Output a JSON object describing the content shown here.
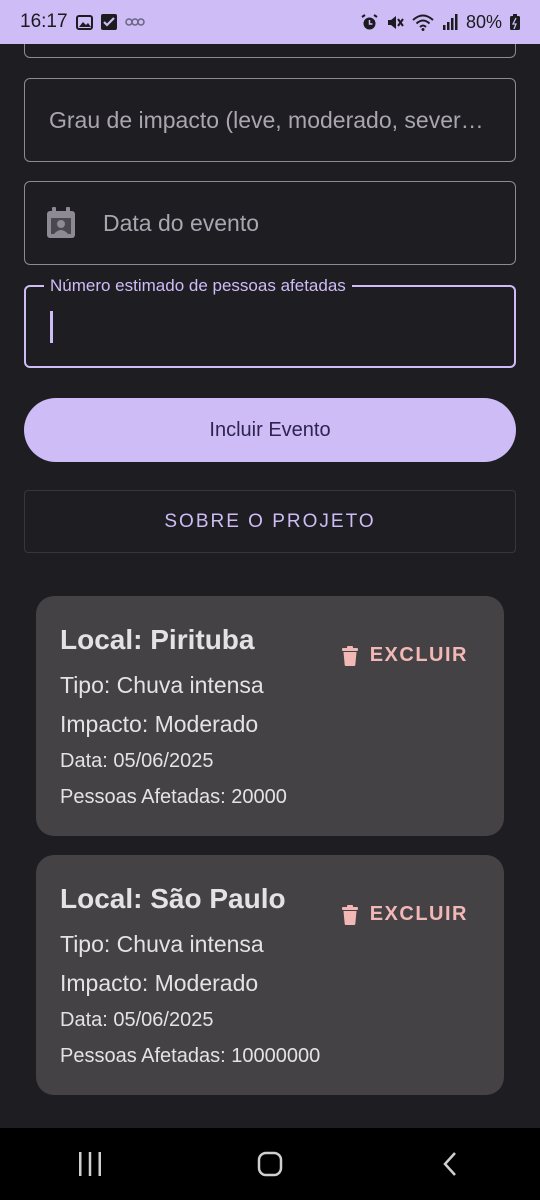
{
  "status_bar": {
    "time": "16:17",
    "battery": "80%"
  },
  "form": {
    "impact_placeholder": "Grau de impacto (leve, moderado, sever…",
    "date_placeholder": "Data do evento",
    "people_label": "Número estimado de pessoas afetadas",
    "people_value": ""
  },
  "buttons": {
    "include": "Incluir Evento",
    "about": "SOBRE O PROJETO"
  },
  "events": [
    {
      "local": "Local: Pirituba",
      "tipo": "Tipo: Chuva intensa",
      "impacto": "Impacto: Moderado",
      "data": "Data: 05/06/2025",
      "pessoas": "Pessoas Afetadas: 20000",
      "delete_label": "EXCLUIR"
    },
    {
      "local": "Local: São Paulo",
      "tipo": "Tipo: Chuva intensa",
      "impacto": "Impacto: Moderado",
      "data": "Data: 05/06/2025",
      "pessoas": "Pessoas Afetadas: 10000000",
      "delete_label": "EXCLUIR"
    }
  ],
  "colors": {
    "accent": "#cdbcf6",
    "background": "#1e1d22",
    "card": "#444245",
    "delete": "#f2b8b5"
  },
  "icons": [
    "image-icon",
    "check-icon",
    "voicemail-icon",
    "alarm-icon",
    "mute-icon",
    "wifi-icon",
    "signal-icon",
    "battery-icon",
    "calendar-icon",
    "trash-icon",
    "recents-icon",
    "home-icon",
    "back-icon"
  ]
}
